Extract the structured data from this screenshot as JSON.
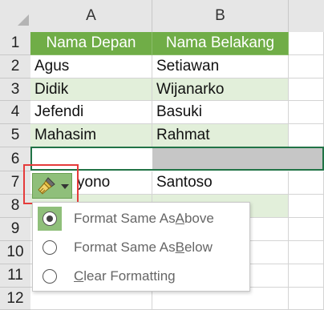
{
  "columns": [
    "A",
    "B"
  ],
  "rows": [
    "1",
    "2",
    "3",
    "4",
    "5",
    "6",
    "7",
    "8",
    "9",
    "10",
    "11",
    "12"
  ],
  "table": {
    "header": [
      "Nama Depan",
      "Nama Belakang"
    ],
    "data": [
      [
        "Agus",
        "Setiawan"
      ],
      [
        "Didik",
        "Wijanarko"
      ],
      [
        "Jefendi",
        "Basuki"
      ],
      [
        "Mahasim",
        "Rahmat"
      ],
      [
        "",
        ""
      ],
      [
        "yono",
        "Santoso"
      ],
      [
        "",
        ""
      ]
    ]
  },
  "paste_options": {
    "icon": "paintbrush-icon",
    "items": [
      {
        "pre": "Format Same As ",
        "ul": "A",
        "post": "bove",
        "selected": true
      },
      {
        "pre": "Format Same As ",
        "ul": "B",
        "post": "elow",
        "selected": false
      },
      {
        "pre": "",
        "ul": "C",
        "post": "lear Formatting",
        "selected": false
      }
    ]
  },
  "colors": {
    "header_fill": "#70ad47",
    "band_fill": "#e2efda",
    "selection_border": "#217346",
    "highlight_box": "#e53b3b"
  }
}
